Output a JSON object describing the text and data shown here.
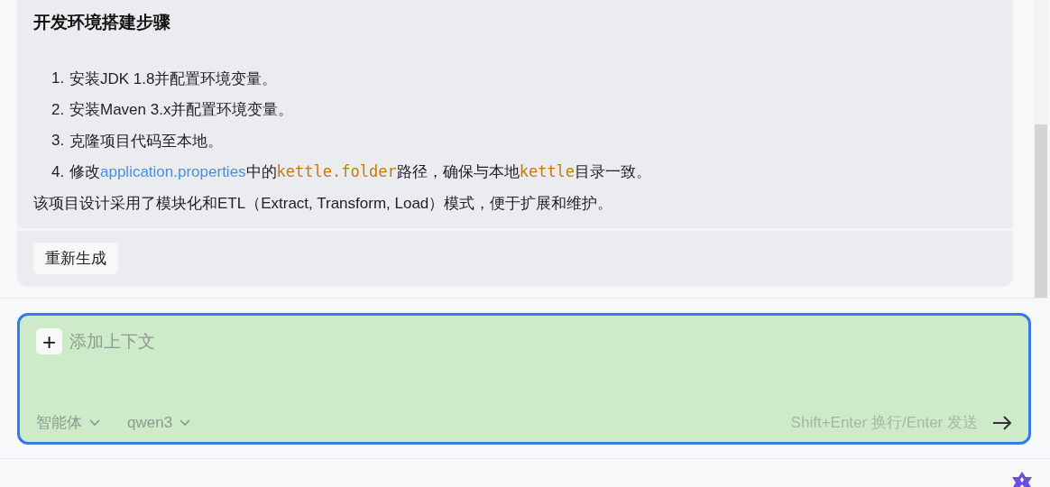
{
  "message": {
    "heading": "开发环境搭建步骤",
    "steps": [
      {
        "number": "1.",
        "parts": [
          {
            "kind": "text",
            "text": "安装JDK 1.8并配置环境变量。"
          }
        ]
      },
      {
        "number": "2.",
        "parts": [
          {
            "kind": "text",
            "text": "安装Maven 3.x并配置环境变量。"
          }
        ]
      },
      {
        "number": "3.",
        "parts": [
          {
            "kind": "text",
            "text": "克隆项目代码至本地。"
          }
        ]
      },
      {
        "number": "4.",
        "parts": [
          {
            "kind": "text",
            "text": "修改"
          },
          {
            "kind": "link",
            "text": "application.properties"
          },
          {
            "kind": "text",
            "text": "中的"
          },
          {
            "kind": "code",
            "text": "kettle.folder"
          },
          {
            "kind": "text",
            "text": "路径，确保与本地"
          },
          {
            "kind": "code",
            "text": "kettle"
          },
          {
            "kind": "text",
            "text": "目录一致。"
          }
        ]
      }
    ],
    "summary": "该项目设计采用了模块化和ETL（Extract, Transform, Load）模式，便于扩展和维护。",
    "regenerate_button": "重新生成"
  },
  "composer": {
    "add_button": "+",
    "placeholder": "添加上下文",
    "dropdowns": [
      {
        "label": "智能体"
      },
      {
        "label": "qwen3"
      }
    ],
    "hint": "Shift+Enter 换行/Enter 发送"
  }
}
